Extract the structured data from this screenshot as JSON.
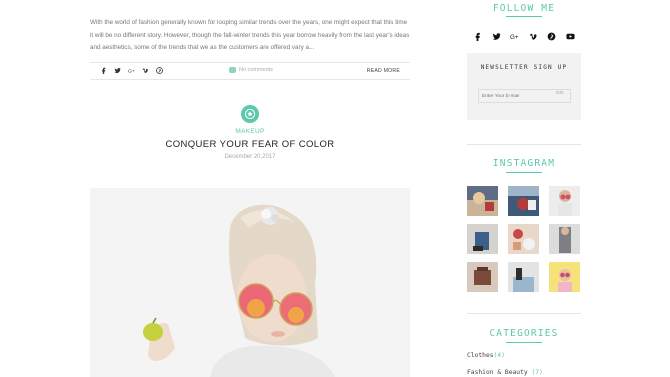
{
  "post_previous": {
    "excerpt": "With the world of fashion generally known for looping similar trends over the years, one might expect that this time it will be no different story. However, though the fall-winter trends this year borrow heavily from the last year’s ideas and aesthetics, some of the trends that we as the customers are offered vary a...",
    "share_icons": [
      "facebook-icon",
      "twitter-icon",
      "google-plus-icon",
      "vimeo-icon",
      "pinterest-icon"
    ],
    "comments_label": "No comments",
    "read_more_label": "READ MORE"
  },
  "post": {
    "category_icon": "star-icon",
    "category": "MAKEUP",
    "title": "CONQUER YOUR FEAR OF COLOR",
    "date": "December 20,2017",
    "hero_image_alt": "woman-with-round-sunglasses-image"
  },
  "sidebar": {
    "follow": {
      "title": "FOLLOW ME",
      "icons": [
        "facebook-icon",
        "twitter-icon",
        "google-plus-icon",
        "vimeo-icon",
        "pinterest-icon",
        "youtube-icon"
      ]
    },
    "newsletter": {
      "title": "NEWSLETTER SIGN UP",
      "placeholder": "Enter Your E-mail",
      "submit_label": "GO"
    },
    "instagram": {
      "title": "INSTAGRAM",
      "thumbs": [
        "instagram-photo-1",
        "instagram-photo-2",
        "instagram-photo-3",
        "instagram-photo-4",
        "instagram-photo-5",
        "instagram-photo-6",
        "instagram-photo-7",
        "instagram-photo-8",
        "instagram-photo-9"
      ]
    },
    "categories": {
      "title": "CATEGORIES",
      "items": [
        {
          "label": "Clothes",
          "count": "(4)"
        },
        {
          "label": "Fashion & Beauty",
          "count": "(7)"
        }
      ]
    }
  },
  "colors": {
    "accent": "#5cc8ad",
    "title_text": "#222222",
    "body_text": "#777777"
  }
}
